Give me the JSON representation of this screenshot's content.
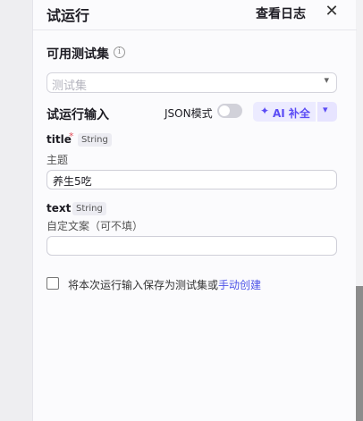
{
  "header": {
    "title": "试运行",
    "view_log": "查看日志",
    "close_icon": "close-icon"
  },
  "testset": {
    "label": "可用测试集",
    "info_icon": "ⓘ",
    "placeholder": "测试集"
  },
  "run_input": {
    "label": "试运行输入",
    "json_mode": "JSON模式",
    "json_mode_on": false,
    "ai_label": "AI 补全"
  },
  "fields": [
    {
      "name": "title",
      "required_mark": "*",
      "type": "String",
      "description": "主题",
      "value": "养生5吃"
    },
    {
      "name": "text",
      "type": "String",
      "description": "自定文案（可不填）",
      "value": ""
    }
  ],
  "save_option": {
    "text": "将本次运行输入保存为测试集或",
    "link": "手动创建",
    "checked": false
  },
  "colors": {
    "accent": "#4d53e8",
    "ai": "#5b4cf5",
    "required": "#e34d59"
  }
}
